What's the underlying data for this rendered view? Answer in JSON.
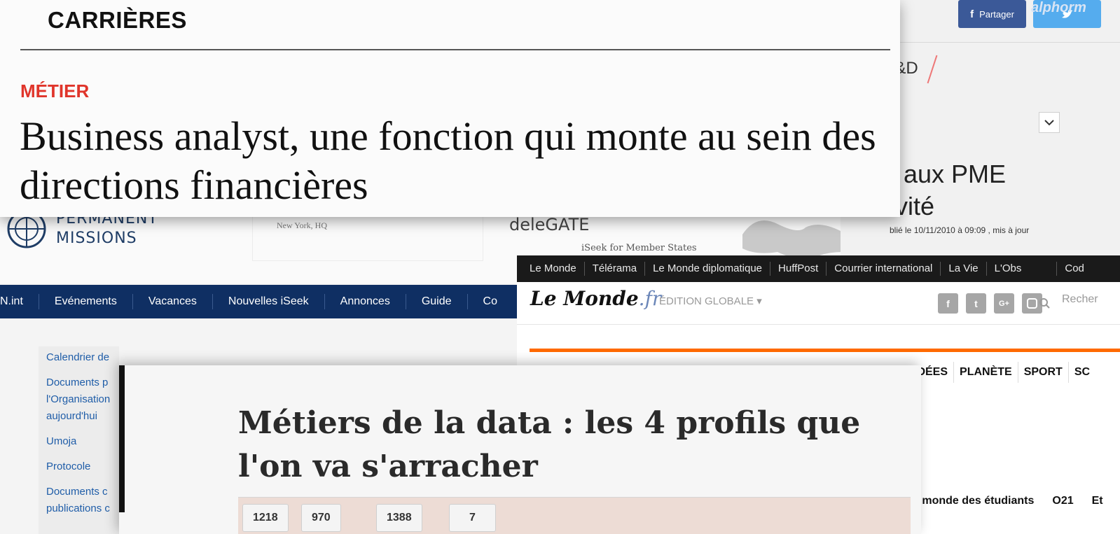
{
  "un_panel": {
    "header_text": "PERMANENT\nMISSIONS",
    "location": "New York, HQ",
    "site_name": "deleGATE",
    "site_subtitle": "iSeek for Member States",
    "nav": [
      "N.int",
      "Evénements",
      "Vacances",
      "Nouvelles iSeek",
      "Annonces",
      "Guide",
      "Co"
    ],
    "sidebar": [
      "Calendrier de",
      "Documents p l'Organisation aujourd'hui",
      "Umoja",
      "Protocole",
      "Documents c publications c"
    ],
    "nav_color": "#0f2f63"
  },
  "rd_panel": {
    "share_label": "Partager",
    "tag": "R&D",
    "headline_line1": "t aux PME",
    "headline_line2": "ivité",
    "date": "blié le 10/11/2010 à 09:09 , mis à jour",
    "logo": "alphorm"
  },
  "lemonde_panel": {
    "top_nav": [
      "Le Monde",
      "Télérama",
      "Le Monde diplomatique",
      "HuffPost",
      "Courrier international",
      "La Vie",
      "L'Obs",
      "Cod"
    ],
    "logo_main": "Le Monde",
    "logo_suffix": ".fr",
    "edition": "ÉDITION GLOBALE ▾",
    "social_icons": [
      "facebook-icon",
      "twitter-icon",
      "googleplus-icon",
      "instagram-icon"
    ],
    "search_label": "Recher",
    "sections": [
      "IDÉES",
      "PLANÈTE",
      "SPORT",
      "SC"
    ],
    "bottom_links": [
      "e monde des étudiants",
      "O21",
      "Et"
    ],
    "accent_color": "#ff6a00"
  },
  "carrieres_panel": {
    "section": "CARRIÈRES",
    "kicker": "MÉTIER",
    "title": "Business analyst, une fonction qui monte au sein des directions financières",
    "kicker_color": "#e0352b"
  },
  "data_panel": {
    "title": "Métiers de la data : les 4 profils que l'on va s'arracher",
    "share_counts": [
      "1218",
      "970",
      "1388",
      "7"
    ]
  }
}
